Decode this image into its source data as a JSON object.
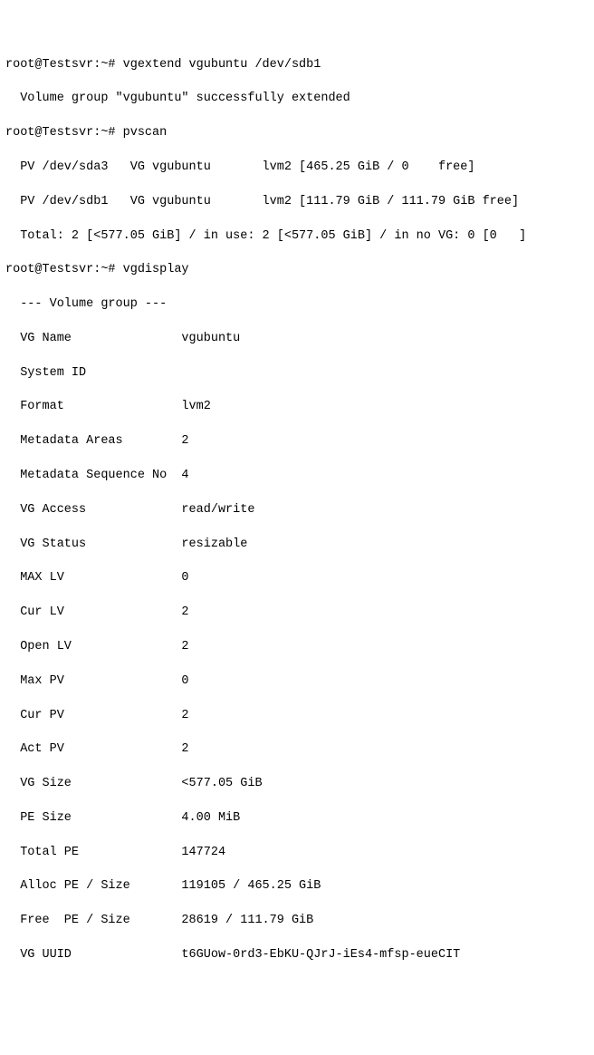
{
  "lines": {
    "l00": "root@Testsvr:~# vgextend vgubuntu /dev/sdb1",
    "l01": "  Volume group \"vgubuntu\" successfully extended",
    "l02": "root@Testsvr:~# pvscan",
    "l03": "  PV /dev/sda3   VG vgubuntu       lvm2 [465.25 GiB / 0    free]",
    "l04": "  PV /dev/sdb1   VG vgubuntu       lvm2 [111.79 GiB / 111.79 GiB free]",
    "l05": "  Total: 2 [<577.05 GiB] / in use: 2 [<577.05 GiB] / in no VG: 0 [0   ]",
    "l06": "root@Testsvr:~# vgdisplay",
    "l07": "  --- Volume group ---",
    "l08": "  VG Name               vgubuntu",
    "l09": "  System ID",
    "l10": "  Format                lvm2",
    "l11": "  Metadata Areas        2",
    "l12": "  Metadata Sequence No  4",
    "l13": "  VG Access             read/write",
    "l14": "  VG Status             resizable",
    "l15": "  MAX LV                0",
    "l16": "  Cur LV                2",
    "l17": "  Open LV               2",
    "l18": "  Max PV                0",
    "l19": "  Cur PV                2",
    "l20": "  Act PV                2",
    "l21": "  VG Size               <577.05 GiB",
    "l22": "  PE Size               4.00 MiB",
    "l23": "  Total PE              147724",
    "l24": "  Alloc PE / Size       119105 / 465.25 GiB",
    "l25": "  Free  PE / Size       28619 / 111.79 GiB",
    "l26": "  VG UUID               t6GUow-0rd3-EbKU-QJrJ-iEs4-mfsp-eueCIT"
  }
}
